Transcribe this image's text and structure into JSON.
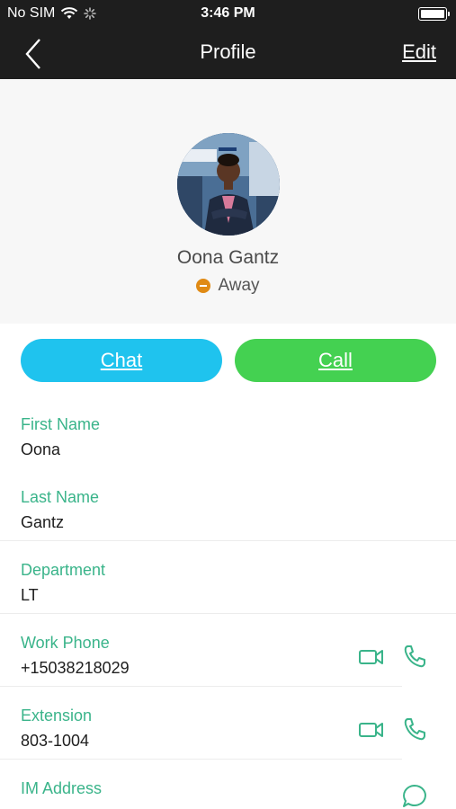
{
  "status_bar": {
    "carrier": "No SIM",
    "time": "3:46 PM",
    "battery_level": 1.0
  },
  "nav": {
    "title": "Profile",
    "edit_label": "Edit",
    "back_icon": "chevron-left-icon"
  },
  "profile": {
    "name": "Oona Gantz",
    "presence": "Away",
    "presence_color": "#e08a14"
  },
  "actions": {
    "chat_label": "Chat",
    "call_label": "Call",
    "chat_color": "#1fc3ee",
    "call_color": "#44d151"
  },
  "fields": [
    {
      "label": "First Name",
      "value": "Oona"
    },
    {
      "label": "Last Name",
      "value": "Gantz"
    },
    {
      "label": "Department",
      "value": "LT"
    },
    {
      "label": "Work Phone",
      "value": "+15038218029",
      "icons": [
        "video-icon",
        "phone-icon"
      ]
    },
    {
      "label": "Extension",
      "value": "803-1004",
      "icons": [
        "video-icon",
        "phone-icon"
      ]
    },
    {
      "label": "IM Address",
      "value": "",
      "icons": [
        "message-icon"
      ]
    }
  ],
  "accent_color": "#3ab48a"
}
